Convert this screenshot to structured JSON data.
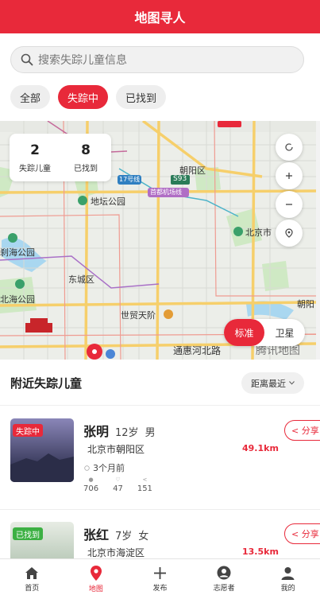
{
  "header": {
    "title": "地图寻人"
  },
  "search": {
    "placeholder": "搜索失踪儿童信息"
  },
  "filters": [
    {
      "label": "全部",
      "active": false
    },
    {
      "label": "失踪中",
      "active": true
    },
    {
      "label": "已找到",
      "active": false
    }
  ],
  "map": {
    "stats": [
      {
        "value": "2",
        "label": "失踪儿童"
      },
      {
        "value": "8",
        "label": "已找到"
      }
    ],
    "labels": [
      "朝阳区",
      "地坛公园",
      "首都机场线",
      "北京市",
      "刹海公园",
      "北海公园",
      "东城区",
      "世贸天阶",
      "朝阳",
      "通惠河北路",
      "腾讯地图",
      "S93",
      "17号线"
    ],
    "controls": [
      "refresh-icon",
      "plus-icon",
      "minus-icon",
      "locate-icon"
    ],
    "type_options": [
      {
        "label": "标准",
        "active": true
      },
      {
        "label": "卫星",
        "active": false
      }
    ]
  },
  "list": {
    "title": "附近失踪儿童",
    "sort_label": "距离最近",
    "items": [
      {
        "status": "失踪中",
        "status_color": "#e8293a",
        "name": "张明",
        "age": "12岁",
        "gender": "男",
        "location": "北京市朝阳区",
        "distance": "49.1km",
        "time": "3个月前",
        "views": "706",
        "likes": "47",
        "shares": "151",
        "share_label": "< 分享"
      },
      {
        "status": "已找到",
        "status_color": "#3cb043",
        "name": "张红",
        "age": "7岁",
        "gender": "女",
        "location": "北京市海淀区",
        "distance": "13.5km",
        "time": "",
        "views": "",
        "likes": "",
        "shares": "",
        "share_label": "< 分享"
      }
    ]
  },
  "tabbar": [
    {
      "label": "首页",
      "icon": "home-icon",
      "active": false
    },
    {
      "label": "地图",
      "icon": "map-pin-icon",
      "active": true
    },
    {
      "label": "发布",
      "icon": "plus-icon",
      "active": false
    },
    {
      "label": "志愿者",
      "icon": "volunteer-icon",
      "active": false
    },
    {
      "label": "我的",
      "icon": "user-icon",
      "active": false
    }
  ],
  "colors": {
    "accent": "#e8293a",
    "found": "#3cb043"
  }
}
